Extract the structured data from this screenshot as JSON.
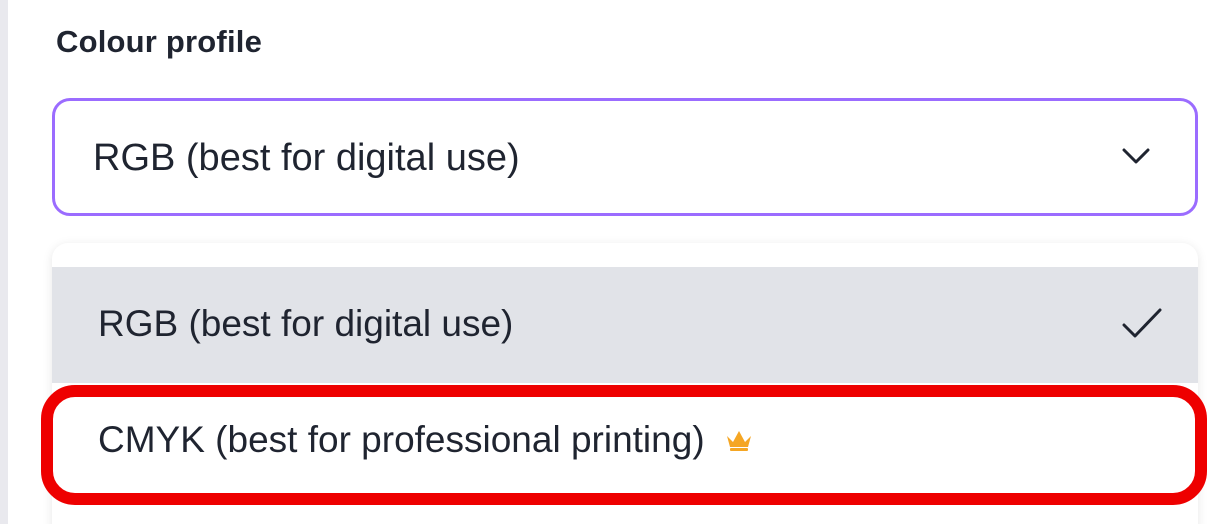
{
  "field": {
    "label": "Colour profile",
    "selected_value": "RGB (best for digital use)"
  },
  "dropdown": {
    "options": [
      {
        "label": "RGB (best for digital use)",
        "selected": true,
        "icon": "check-icon"
      },
      {
        "label": "CMYK (best for professional printing)",
        "selected": false,
        "icon": "crown-icon"
      }
    ]
  },
  "colors": {
    "focus_border": "#9b6cff",
    "selected_row_bg": "#e1e3e8",
    "crown": "#f5a623",
    "highlight": "#ee0000"
  }
}
